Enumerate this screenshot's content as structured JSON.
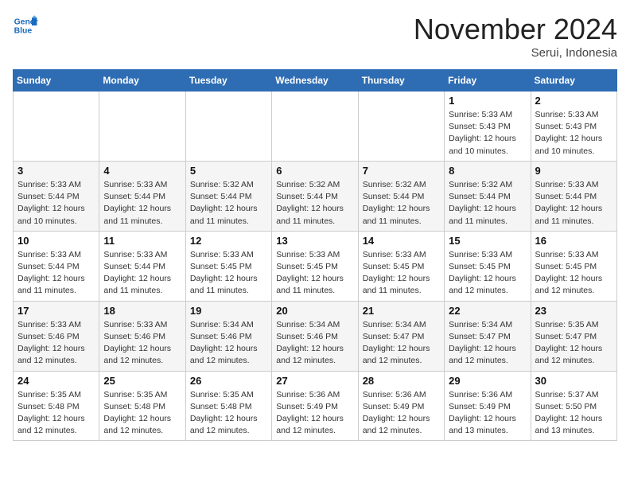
{
  "header": {
    "logo_line1": "General",
    "logo_line2": "Blue",
    "month": "November 2024",
    "location": "Serui, Indonesia"
  },
  "days_of_week": [
    "Sunday",
    "Monday",
    "Tuesday",
    "Wednesday",
    "Thursday",
    "Friday",
    "Saturday"
  ],
  "weeks": [
    [
      {
        "day": "",
        "detail": ""
      },
      {
        "day": "",
        "detail": ""
      },
      {
        "day": "",
        "detail": ""
      },
      {
        "day": "",
        "detail": ""
      },
      {
        "day": "",
        "detail": ""
      },
      {
        "day": "1",
        "detail": "Sunrise: 5:33 AM\nSunset: 5:43 PM\nDaylight: 12 hours\nand 10 minutes."
      },
      {
        "day": "2",
        "detail": "Sunrise: 5:33 AM\nSunset: 5:43 PM\nDaylight: 12 hours\nand 10 minutes."
      }
    ],
    [
      {
        "day": "3",
        "detail": "Sunrise: 5:33 AM\nSunset: 5:44 PM\nDaylight: 12 hours\nand 10 minutes."
      },
      {
        "day": "4",
        "detail": "Sunrise: 5:33 AM\nSunset: 5:44 PM\nDaylight: 12 hours\nand 11 minutes."
      },
      {
        "day": "5",
        "detail": "Sunrise: 5:32 AM\nSunset: 5:44 PM\nDaylight: 12 hours\nand 11 minutes."
      },
      {
        "day": "6",
        "detail": "Sunrise: 5:32 AM\nSunset: 5:44 PM\nDaylight: 12 hours\nand 11 minutes."
      },
      {
        "day": "7",
        "detail": "Sunrise: 5:32 AM\nSunset: 5:44 PM\nDaylight: 12 hours\nand 11 minutes."
      },
      {
        "day": "8",
        "detail": "Sunrise: 5:32 AM\nSunset: 5:44 PM\nDaylight: 12 hours\nand 11 minutes."
      },
      {
        "day": "9",
        "detail": "Sunrise: 5:33 AM\nSunset: 5:44 PM\nDaylight: 12 hours\nand 11 minutes."
      }
    ],
    [
      {
        "day": "10",
        "detail": "Sunrise: 5:33 AM\nSunset: 5:44 PM\nDaylight: 12 hours\nand 11 minutes."
      },
      {
        "day": "11",
        "detail": "Sunrise: 5:33 AM\nSunset: 5:44 PM\nDaylight: 12 hours\nand 11 minutes."
      },
      {
        "day": "12",
        "detail": "Sunrise: 5:33 AM\nSunset: 5:45 PM\nDaylight: 12 hours\nand 11 minutes."
      },
      {
        "day": "13",
        "detail": "Sunrise: 5:33 AM\nSunset: 5:45 PM\nDaylight: 12 hours\nand 11 minutes."
      },
      {
        "day": "14",
        "detail": "Sunrise: 5:33 AM\nSunset: 5:45 PM\nDaylight: 12 hours\nand 11 minutes."
      },
      {
        "day": "15",
        "detail": "Sunrise: 5:33 AM\nSunset: 5:45 PM\nDaylight: 12 hours\nand 12 minutes."
      },
      {
        "day": "16",
        "detail": "Sunrise: 5:33 AM\nSunset: 5:45 PM\nDaylight: 12 hours\nand 12 minutes."
      }
    ],
    [
      {
        "day": "17",
        "detail": "Sunrise: 5:33 AM\nSunset: 5:46 PM\nDaylight: 12 hours\nand 12 minutes."
      },
      {
        "day": "18",
        "detail": "Sunrise: 5:33 AM\nSunset: 5:46 PM\nDaylight: 12 hours\nand 12 minutes."
      },
      {
        "day": "19",
        "detail": "Sunrise: 5:34 AM\nSunset: 5:46 PM\nDaylight: 12 hours\nand 12 minutes."
      },
      {
        "day": "20",
        "detail": "Sunrise: 5:34 AM\nSunset: 5:46 PM\nDaylight: 12 hours\nand 12 minutes."
      },
      {
        "day": "21",
        "detail": "Sunrise: 5:34 AM\nSunset: 5:47 PM\nDaylight: 12 hours\nand 12 minutes."
      },
      {
        "day": "22",
        "detail": "Sunrise: 5:34 AM\nSunset: 5:47 PM\nDaylight: 12 hours\nand 12 minutes."
      },
      {
        "day": "23",
        "detail": "Sunrise: 5:35 AM\nSunset: 5:47 PM\nDaylight: 12 hours\nand 12 minutes."
      }
    ],
    [
      {
        "day": "24",
        "detail": "Sunrise: 5:35 AM\nSunset: 5:48 PM\nDaylight: 12 hours\nand 12 minutes."
      },
      {
        "day": "25",
        "detail": "Sunrise: 5:35 AM\nSunset: 5:48 PM\nDaylight: 12 hours\nand 12 minutes."
      },
      {
        "day": "26",
        "detail": "Sunrise: 5:35 AM\nSunset: 5:48 PM\nDaylight: 12 hours\nand 12 minutes."
      },
      {
        "day": "27",
        "detail": "Sunrise: 5:36 AM\nSunset: 5:49 PM\nDaylight: 12 hours\nand 12 minutes."
      },
      {
        "day": "28",
        "detail": "Sunrise: 5:36 AM\nSunset: 5:49 PM\nDaylight: 12 hours\nand 12 minutes."
      },
      {
        "day": "29",
        "detail": "Sunrise: 5:36 AM\nSunset: 5:49 PM\nDaylight: 12 hours\nand 13 minutes."
      },
      {
        "day": "30",
        "detail": "Sunrise: 5:37 AM\nSunset: 5:50 PM\nDaylight: 12 hours\nand 13 minutes."
      }
    ]
  ]
}
